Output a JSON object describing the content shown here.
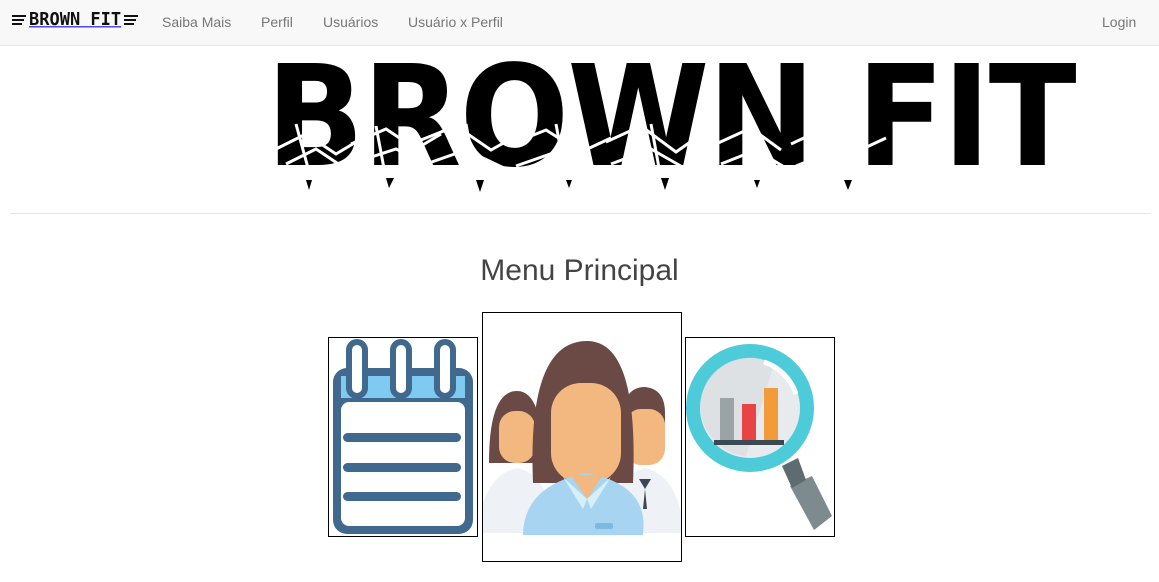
{
  "navbar": {
    "brand": "BROWN FIT",
    "links": [
      "Saiba Mais",
      "Perfil",
      "Usuários",
      "Usuário x Perfil"
    ],
    "login": "Login"
  },
  "hero": {
    "logo_text": "BROWN FIT"
  },
  "main": {
    "title": "Menu Principal",
    "tiles": [
      {
        "icon": "notepad-icon"
      },
      {
        "icon": "users-icon"
      },
      {
        "icon": "report-search-icon"
      }
    ]
  },
  "colors": {
    "navbar_bg": "#f8f8f8",
    "nav_text": "#777777",
    "notepad_blue": "#41698e",
    "notepad_light": "#7fcaf0",
    "report_teal": "#4ecbd9"
  }
}
